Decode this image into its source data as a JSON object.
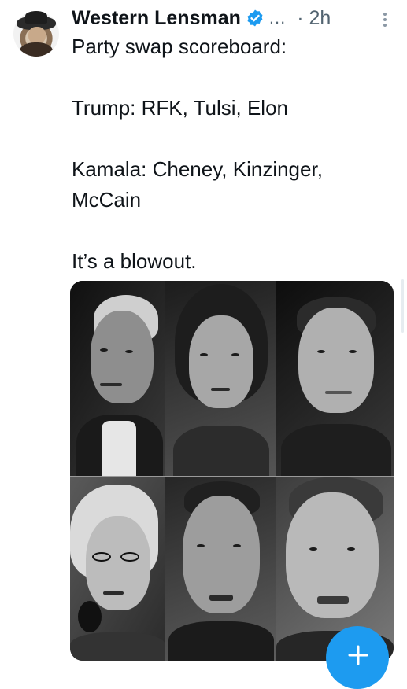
{
  "tweet": {
    "author_name": "Western Lensman",
    "author_overflow": "...",
    "time_separator": "·",
    "timestamp": "2h",
    "verified": true,
    "text_lines": [
      "Party swap scoreboard:",
      "",
      "Trump: RFK, Tulsi, Elon",
      "",
      "Kamala: Cheney, Kinzinger,",
      "McCain",
      "",
      "It’s a blowout."
    ]
  },
  "media": {
    "layout": "3x2 grid of black-and-white portrait photos"
  },
  "icons": {
    "verified": "verified-badge-icon",
    "more": "more-vertical-icon",
    "compose": "plus-icon"
  },
  "colors": {
    "text": "#0f1419",
    "muted": "#536471",
    "accent": "#1d9bf0"
  }
}
